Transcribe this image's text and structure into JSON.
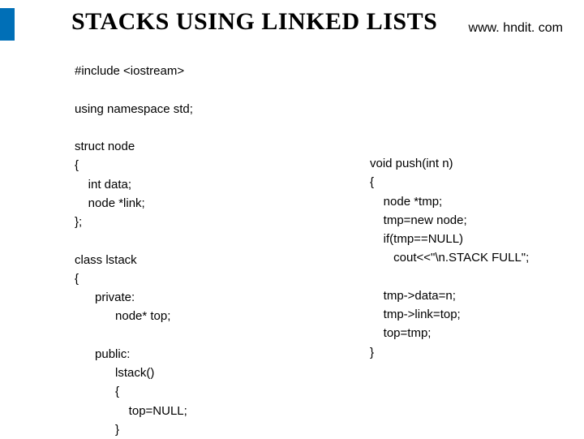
{
  "title": "STACKS USING LINKED LISTS",
  "url": "www. hndit. com",
  "code_left": "#include <iostream>\n\nusing namespace std;\n\nstruct node\n{\n    int data;\n    node *link;\n};\n\nclass lstack\n{\n      private:\n            node* top;\n\n      public:\n            lstack()\n            {\n                top=NULL;\n            }",
  "code_right": "void push(int n)\n{\n    node *tmp;\n    tmp=new node;\n    if(tmp==NULL)\n       cout<<\"\\n.STACK FULL\";\n\n    tmp->data=n;\n    tmp->link=top;\n    top=tmp;\n}"
}
